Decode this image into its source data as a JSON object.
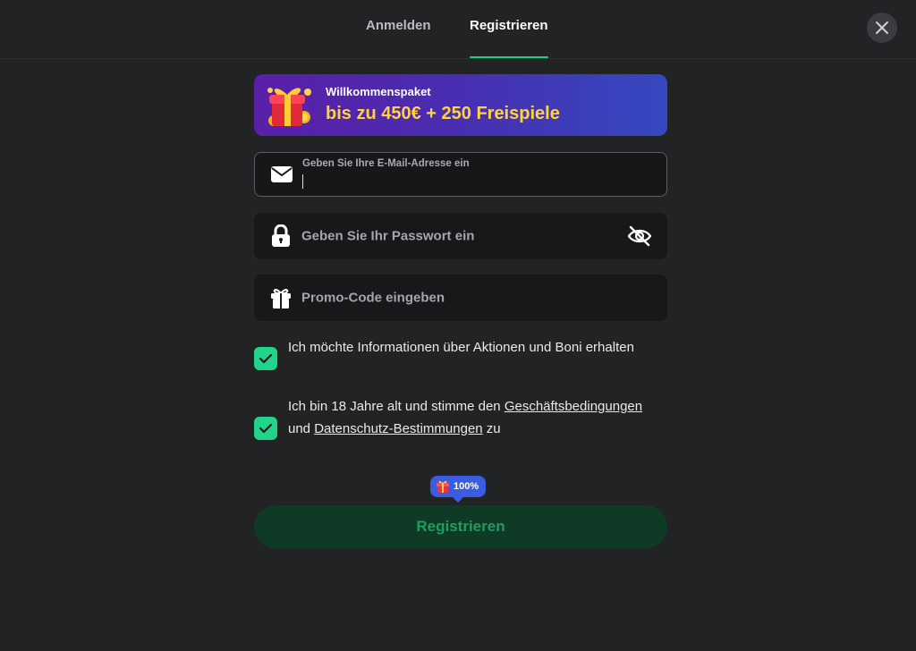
{
  "tabs": {
    "login_label": "Anmelden",
    "register_label": "Registrieren",
    "active": "register"
  },
  "close_icon": "close-icon",
  "banner": {
    "small_text": "Willkommenspaket",
    "big_text": "bis zu 450€ + 250 Freispiele",
    "icon": "gift-box-icon"
  },
  "email_field": {
    "label": "Geben Sie Ihre E-Mail-Adresse ein",
    "value": "",
    "icon": "envelope-icon"
  },
  "password_field": {
    "placeholder": "Geben Sie Ihr Passwort ein",
    "icon": "lock-icon",
    "toggle_icon": "eye-off-icon"
  },
  "promo_field": {
    "placeholder": "Promo-Code eingeben",
    "icon": "gift-icon"
  },
  "checkboxes": {
    "newsletter": {
      "checked": true,
      "text": "Ich möchte Informationen über Aktionen und Boni erhalten"
    },
    "terms": {
      "checked": true,
      "text_before": "Ich bin 18 Jahre alt und stimme den ",
      "link_terms": "Geschäftsbedingungen",
      "text_middle": " und ",
      "link_privacy": "Datenschutz-Bestimmungen",
      "text_after": " zu"
    }
  },
  "bonus_badge": {
    "percent": "100%",
    "icon": "gift-icon"
  },
  "submit": {
    "label": "Registrieren"
  },
  "colors": {
    "background": "#222325",
    "accent": "#1fd187",
    "checkbox": "#20d489",
    "submit_bg": "#0f3a25",
    "submit_text": "#1f9d5f",
    "banner_yellow": "#ffd23f",
    "badge_blue": "#3a5ce0"
  }
}
